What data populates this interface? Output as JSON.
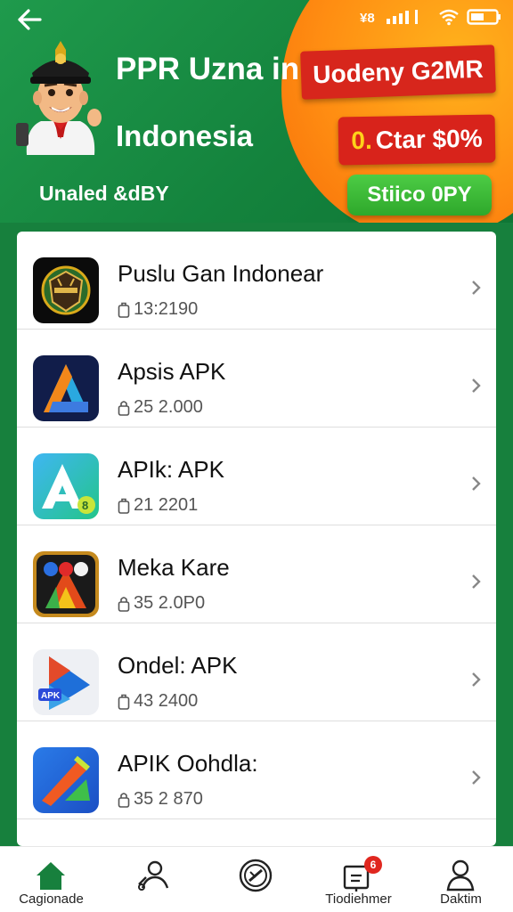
{
  "header": {
    "title_line1": "PPR Uzna in",
    "title_line2": "Indonesia",
    "subtitle": "Unaled &dBY",
    "promo_banner": "Uodeny G2MR",
    "promo_sale_prefix": "0.",
    "promo_sale": "Ctar $0%",
    "cta_label": "Stiico 0PY",
    "back_icon": "arrow-left-icon",
    "status_icons": [
      "signal-icon",
      "wifi-icon",
      "battery-icon"
    ]
  },
  "apps": [
    {
      "name": "Puslu Gan Indonear",
      "meta": "13:2190",
      "icon": "police-badge-icon"
    },
    {
      "name": "Apsis APK",
      "meta": "25 2.000",
      "icon": "app-a-blue-icon"
    },
    {
      "name": "APIk: APK",
      "meta": "21 2201",
      "icon": "app-a-white-icon"
    },
    {
      "name": "Meka Kare",
      "meta": "35 2.0P0",
      "icon": "colorful-game-icon"
    },
    {
      "name": "Ondel: APK",
      "meta": "43 2400",
      "icon": "play-arrow-icon"
    },
    {
      "name": "APIK Oohdla:",
      "meta": "35 2 870",
      "icon": "brush-app-icon"
    }
  ],
  "nav": [
    {
      "label": "Cagionade",
      "icon": "home-icon",
      "active": true
    },
    {
      "label": "",
      "icon": "people-icon"
    },
    {
      "label": "",
      "icon": "shield-icon"
    },
    {
      "label": "Tiodiehmer",
      "icon": "inbox-icon",
      "badge": "6"
    },
    {
      "label": "Daktim",
      "icon": "profile-icon"
    }
  ],
  "colors": {
    "header_green": "#1a9145",
    "accent_orange": "#ff8d12",
    "promo_red": "#d7261c",
    "cta_green": "#38b334",
    "active_nav": "#17803d"
  }
}
